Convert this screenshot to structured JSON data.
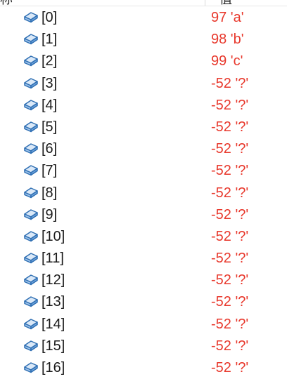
{
  "header": {
    "name_label": "称",
    "value_label": "值"
  },
  "value_color": "#e8382c",
  "icon": "field-cube-icon",
  "rows": [
    {
      "name": "[0]",
      "value": "97 'a'"
    },
    {
      "name": "[1]",
      "value": "98 'b'"
    },
    {
      "name": "[2]",
      "value": "99 'c'"
    },
    {
      "name": "[3]",
      "value": "-52 '?'"
    },
    {
      "name": "[4]",
      "value": "-52 '?'"
    },
    {
      "name": "[5]",
      "value": "-52 '?'"
    },
    {
      "name": "[6]",
      "value": "-52 '?'"
    },
    {
      "name": "[7]",
      "value": "-52 '?'"
    },
    {
      "name": "[8]",
      "value": "-52 '?'"
    },
    {
      "name": "[9]",
      "value": "-52 '?'"
    },
    {
      "name": "[10]",
      "value": "-52 '?'"
    },
    {
      "name": "[11]",
      "value": "-52 '?'"
    },
    {
      "name": "[12]",
      "value": "-52 '?'"
    },
    {
      "name": "[13]",
      "value": "-52 '?'"
    },
    {
      "name": "[14]",
      "value": "-52 '?'"
    },
    {
      "name": "[15]",
      "value": "-52 '?'"
    },
    {
      "name": "[16]",
      "value": "-52 '?'"
    }
  ]
}
